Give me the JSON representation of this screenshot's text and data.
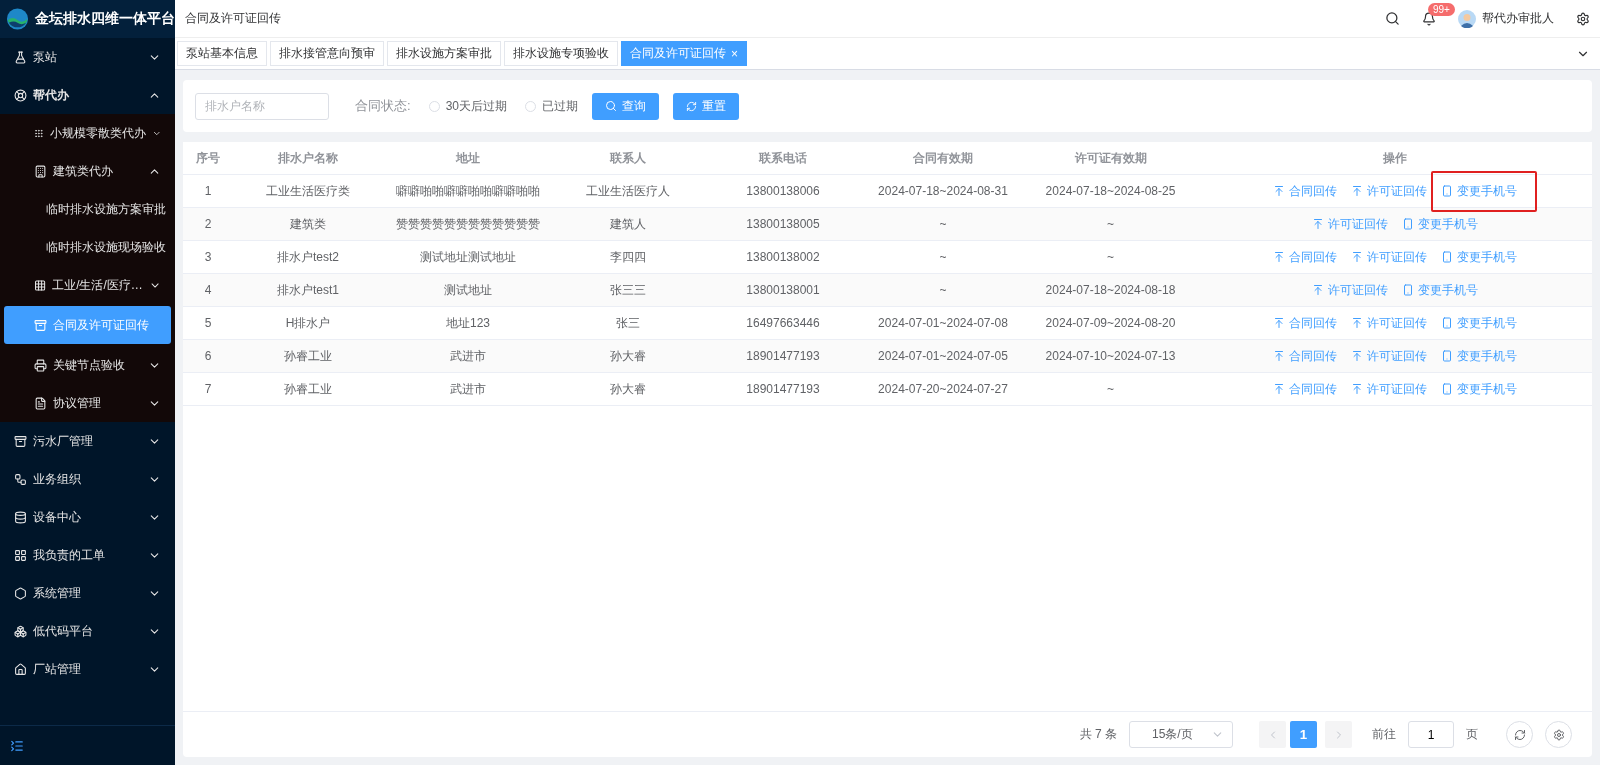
{
  "app": {
    "title": "金坛排水四维一体平台"
  },
  "sidebar": {
    "items": [
      {
        "label": "泵站",
        "expanded": false,
        "selected": false
      },
      {
        "label": "帮代办",
        "expanded": true,
        "selected": false,
        "children": [
          {
            "label": "小规模零散类代办",
            "expanded": false,
            "selected": false
          },
          {
            "label": "建筑类代办",
            "expanded": true,
            "selected": false,
            "children": [
              {
                "label": "临时排水设施方案审批",
                "selected": false
              },
              {
                "label": "临时排水设施现场验收",
                "selected": false
              }
            ]
          },
          {
            "label": "工业/生活/医疗…",
            "expanded": false,
            "selected": false
          },
          {
            "label": "合同及许可证回传",
            "selected": true
          },
          {
            "label": "关键节点验收",
            "expanded": false,
            "selected": false
          },
          {
            "label": "协议管理",
            "expanded": false,
            "selected": false
          }
        ]
      },
      {
        "label": "污水厂管理",
        "expanded": false,
        "selected": false
      },
      {
        "label": "业务组织",
        "expanded": false,
        "selected": false
      },
      {
        "label": "设备中心",
        "expanded": false,
        "selected": false
      },
      {
        "label": "我负责的工单",
        "expanded": false,
        "selected": false
      },
      {
        "label": "系统管理",
        "expanded": false,
        "selected": false
      },
      {
        "label": "低代码平台",
        "expanded": false,
        "selected": false
      },
      {
        "label": "厂站管理",
        "expanded": false,
        "selected": false
      }
    ]
  },
  "header": {
    "breadcrumb": "合同及许可证回传",
    "badge": "99+",
    "user": "帮代办审批人"
  },
  "tabs": [
    {
      "label": "泵站基本信息",
      "selected": false
    },
    {
      "label": "排水接管意向预审",
      "selected": false
    },
    {
      "label": "排水设施方案审批",
      "selected": false
    },
    {
      "label": "排水设施专项验收",
      "selected": false
    },
    {
      "label": "合同及许可证回传",
      "selected": true,
      "close": "×"
    }
  ],
  "filter": {
    "placeholder": "排水户名称",
    "status_label": "合同状态:",
    "options": [
      {
        "label": "30天后过期",
        "selected": false
      },
      {
        "label": "已过期",
        "selected": false
      }
    ],
    "buttons": [
      {
        "kind": "search",
        "label": "查询"
      },
      {
        "kind": "reset",
        "label": "重置"
      }
    ]
  },
  "table": {
    "columns": [
      "序号",
      "排水户名称",
      "地址",
      "联系人",
      "联系电话",
      "合同有效期",
      "许可证有效期",
      "操作"
    ],
    "rows": [
      {
        "cells": [
          "1",
          "工业生活医疗类",
          "噼噼啪啪噼噼啪啪噼噼啪啪",
          "工业生活医疗人",
          "13800138006",
          "2024-07-18~2024-08-31",
          "2024-07-18~2024-08-25"
        ],
        "actions": [
          {
            "kind": "upload",
            "label": "合同回传"
          },
          {
            "kind": "upload",
            "label": "许可证回传"
          },
          {
            "kind": "phone",
            "label": "变更手机号",
            "highlighted": true
          }
        ]
      },
      {
        "cells": [
          "2",
          "建筑类",
          "赞赞赞赞赞赞赞赞赞赞赞赞",
          "建筑人",
          "13800138005",
          "~",
          "~"
        ],
        "actions": [
          {
            "kind": "upload",
            "label": "许可证回传"
          },
          {
            "kind": "phone",
            "label": "变更手机号"
          }
        ]
      },
      {
        "cells": [
          "3",
          "排水户test2",
          "测试地址测试地址",
          "李四四",
          "13800138002",
          "~",
          "~"
        ],
        "actions": [
          {
            "kind": "upload",
            "label": "合同回传"
          },
          {
            "kind": "upload",
            "label": "许可证回传"
          },
          {
            "kind": "phone",
            "label": "变更手机号"
          }
        ]
      },
      {
        "cells": [
          "4",
          "排水户test1",
          "测试地址",
          "张三三",
          "13800138001",
          "~",
          "2024-07-18~2024-08-18"
        ],
        "actions": [
          {
            "kind": "upload",
            "label": "许可证回传"
          },
          {
            "kind": "phone",
            "label": "变更手机号"
          }
        ]
      },
      {
        "cells": [
          "5",
          "H排水户",
          "地址123",
          "张三",
          "16497663446",
          "2024-07-01~2024-07-08",
          "2024-07-09~2024-08-20"
        ],
        "actions": [
          {
            "kind": "upload",
            "label": "合同回传"
          },
          {
            "kind": "upload",
            "label": "许可证回传"
          },
          {
            "kind": "phone",
            "label": "变更手机号"
          }
        ]
      },
      {
        "cells": [
          "6",
          "孙睿工业",
          "武进市",
          "孙大睿",
          "18901477193",
          "2024-07-01~2024-07-05",
          "2024-07-10~2024-07-13"
        ],
        "actions": [
          {
            "kind": "upload",
            "label": "合同回传"
          },
          {
            "kind": "upload",
            "label": "许可证回传"
          },
          {
            "kind": "phone",
            "label": "变更手机号"
          }
        ]
      },
      {
        "cells": [
          "7",
          "孙睿工业",
          "武进市",
          "孙大睿",
          "18901477193",
          "2024-07-20~2024-07-27",
          "~"
        ],
        "actions": [
          {
            "kind": "upload",
            "label": "合同回传"
          },
          {
            "kind": "upload",
            "label": "许可证回传"
          },
          {
            "kind": "phone",
            "label": "变更手机号"
          }
        ]
      }
    ]
  },
  "pagination": {
    "total": "共 7 条",
    "page_size": "15条/页",
    "pages": [
      {
        "label": "1",
        "selected": true
      }
    ],
    "goto_label": "前往",
    "goto_value": "1",
    "goto_suffix": "页"
  }
}
